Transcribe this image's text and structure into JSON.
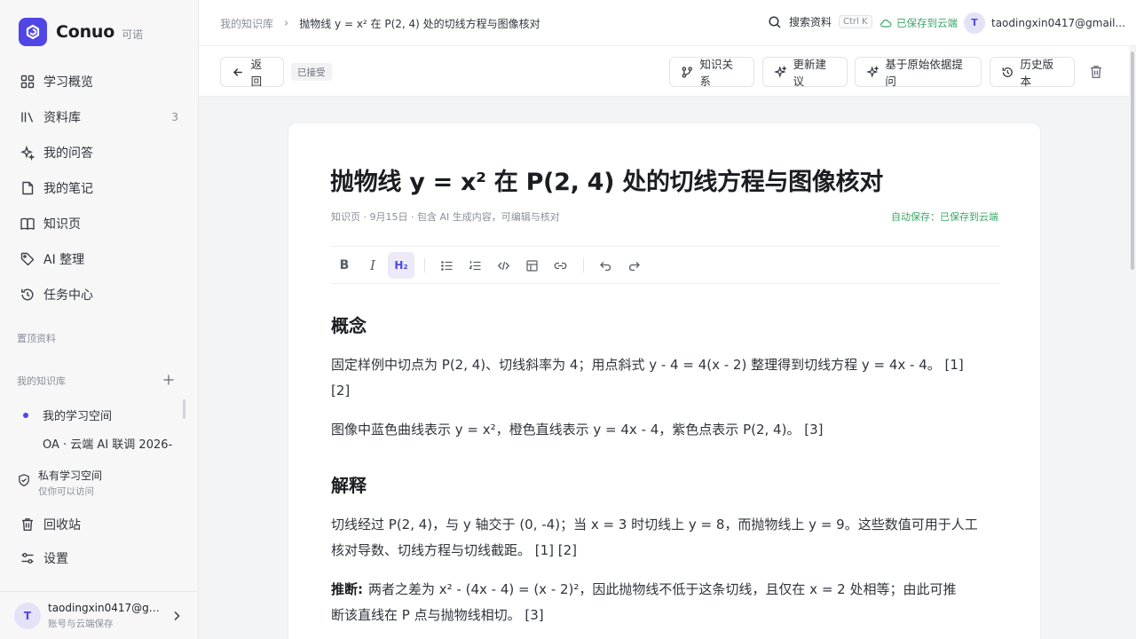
{
  "brand": {
    "name": "Conuo",
    "sub": "可诺",
    "accent": "#4f46e5"
  },
  "nav": {
    "items": [
      {
        "label": "学习概览",
        "icon": "grid-icon"
      },
      {
        "label": "资料库",
        "icon": "library-icon",
        "count": "3"
      },
      {
        "label": "我的问答",
        "icon": "sparkle-icon"
      },
      {
        "label": "我的笔记",
        "icon": "note-icon"
      },
      {
        "label": "知识页",
        "icon": "book-icon"
      },
      {
        "label": "AI 整理",
        "icon": "tag-icon"
      },
      {
        "label": "任务中心",
        "icon": "history-icon"
      }
    ]
  },
  "sections": {
    "pinned": "置顶资料",
    "my_kb": "我的知识库"
  },
  "kb_items": [
    {
      "label": "我的学习空间"
    },
    {
      "label": "OA · 云端 AI 联调 2026-"
    }
  ],
  "private_space": {
    "title": "私有学习空间",
    "sub": "仅你可以访问"
  },
  "bottom_nav": {
    "trash": "回收站",
    "settings": "设置"
  },
  "profile": {
    "initial": "T",
    "email": "taodingxin0417@gmai...",
    "sub": "账号与云端保存"
  },
  "topbar": {
    "breadcrumb_root": "我的知识库",
    "breadcrumb_sep": "›",
    "breadcrumb_current": "抛物线 y = x² 在 P(2, 4) 处的切线方程与图像核对",
    "search_label": "搜索资料",
    "search_shortcut": "Ctrl K",
    "cloud_status": "已保存到云端",
    "user_initial": "T",
    "user_email": "taodingxin0417@gmail..."
  },
  "toolbar": {
    "back": "返回",
    "status_tag": "已接受",
    "relations": "知识关系",
    "suggest": "更新建议",
    "ask": "基于原始依据提问",
    "history": "历史版本"
  },
  "doc": {
    "title": "抛物线 y = x² 在 P(2, 4) 处的切线方程与图像核对",
    "meta": "知识页 · 9月15日 · 包含 AI 生成内容，可编辑与核对",
    "autosave": "自动保存：已保存到云端",
    "format_buttons": [
      "B",
      "I",
      "H₂"
    ],
    "h_concept": "概念",
    "p1_line1": "固定样例中切点为 P(2, 4)、切线斜率为 4；用点斜式 y - 4 = 4(x - 2) 整理得到切线方程 y = 4x - 4。 [1]",
    "p1_line2": "[2]",
    "p2": "图像中蓝色曲线表示 y = x²，橙色直线表示 y = 4x - 4，紫色点表示 P(2, 4)。 [3]",
    "h_explain": "解释",
    "p3_line1": "切线经过 P(2, 4)，与 y 轴交于 (0, -4)；当 x = 3 时切线上 y = 8，而抛物线上 y = 9。这些数值可用于人工",
    "p3_line2": "核对导数、切线方程与切线截距。 [1] [2]",
    "p4_label": "推断:",
    "p4_line1": "两者之差为 x² - (4x - 4) = (x - 2)²，因此抛物线不低于这条切线，且仅在 x = 2 处相等；由此可推",
    "p4_line2": "断该直线在 P 点与抛物线相切。 [3]"
  }
}
